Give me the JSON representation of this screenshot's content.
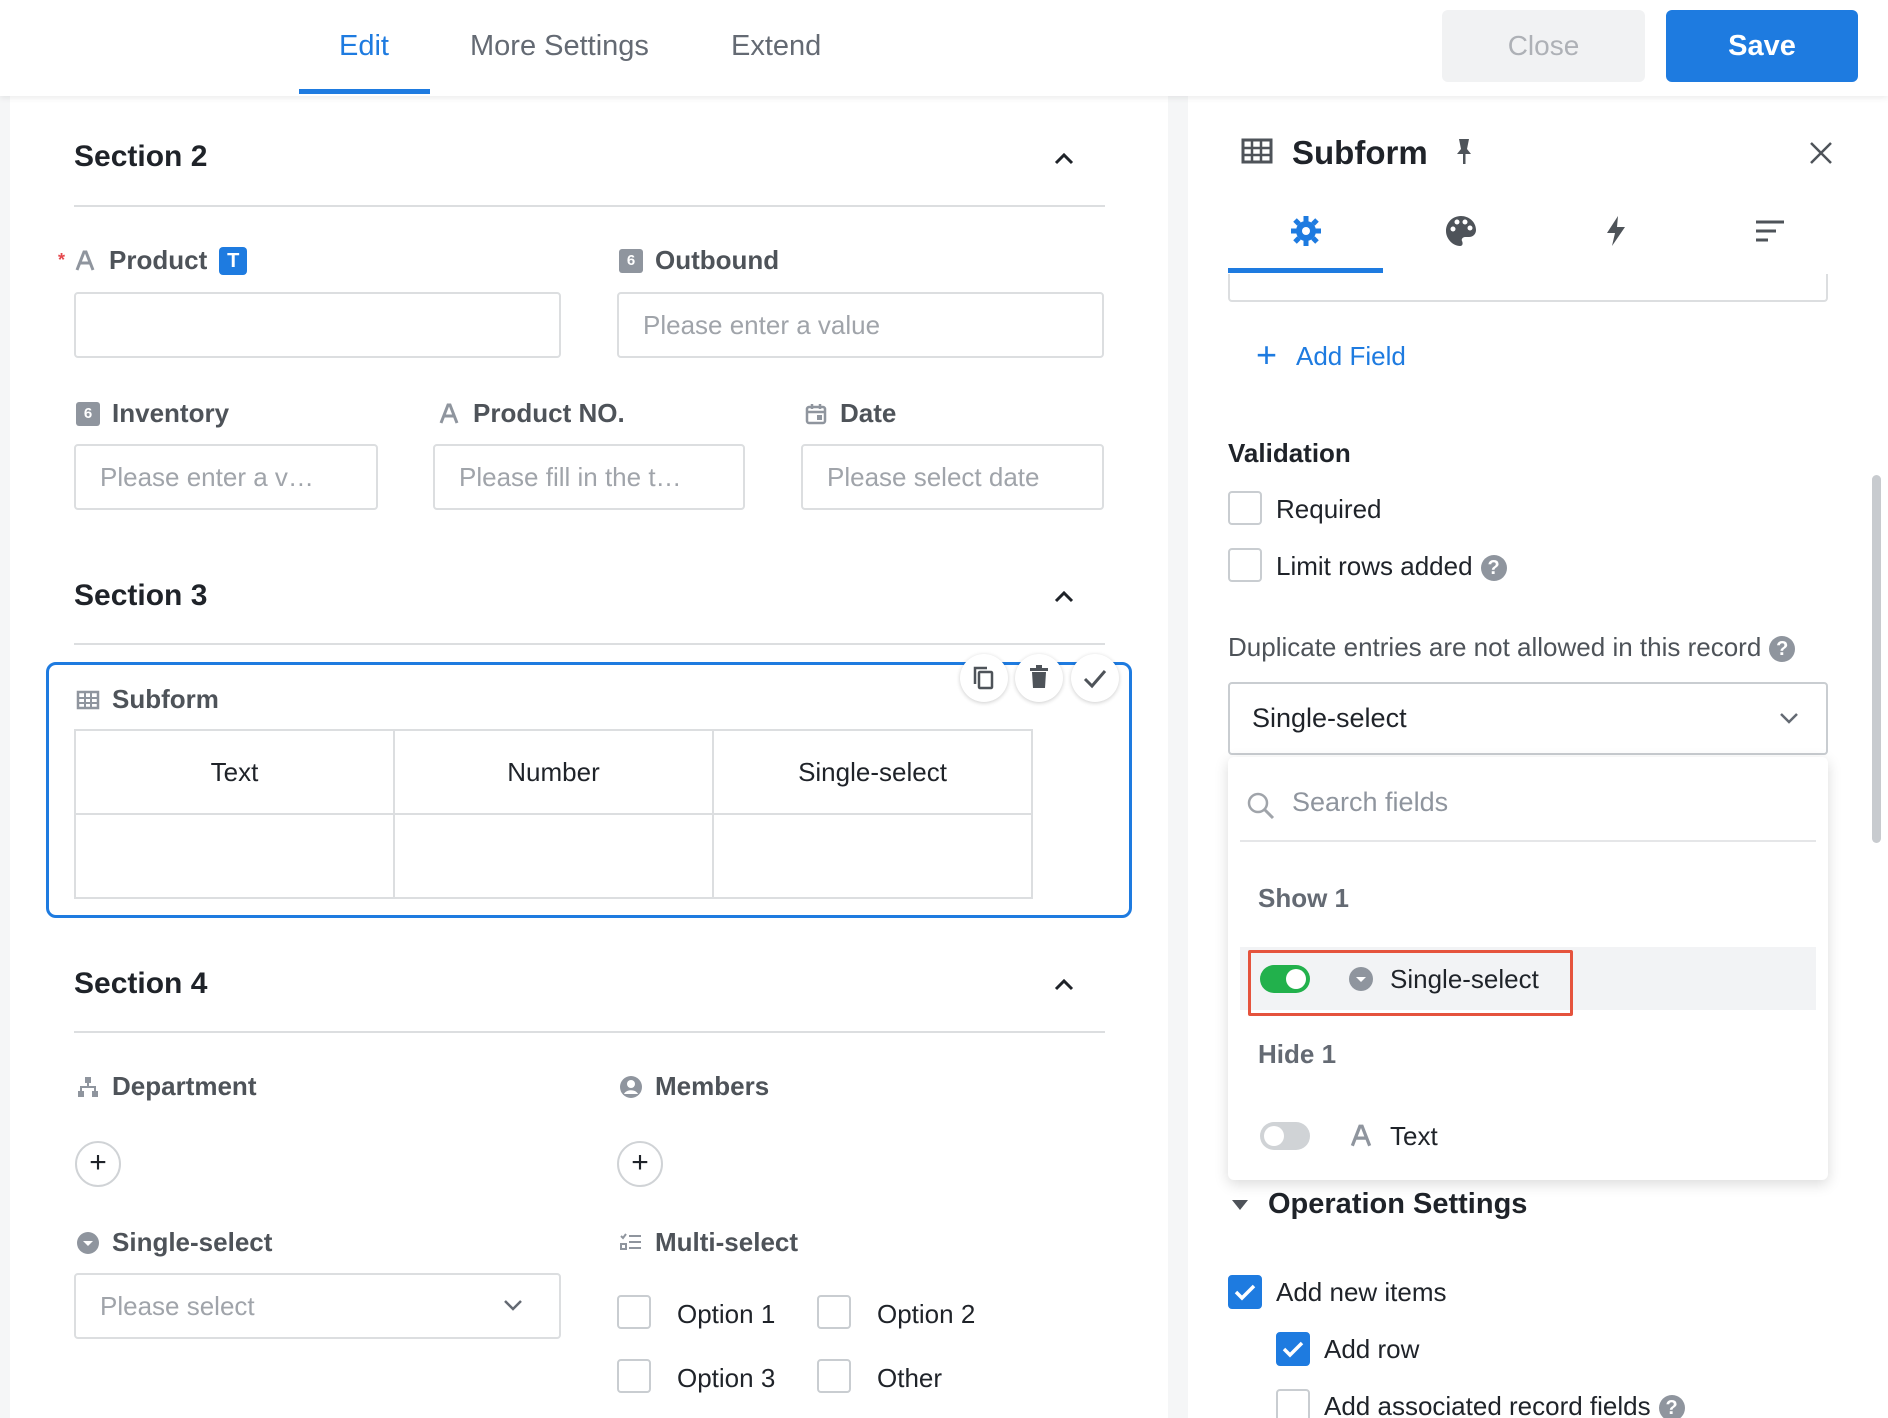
{
  "header": {
    "tabs": [
      {
        "label": "Edit",
        "active": true
      },
      {
        "label": "More Settings",
        "active": false
      },
      {
        "label": "Extend",
        "active": false
      }
    ],
    "close_label": "Close",
    "save_label": "Save",
    "accent_color": "#1e7be0"
  },
  "canvas": {
    "section2": {
      "title": "Section 2",
      "product_label": "Product",
      "product_badge": "T",
      "outbound_label": "Outbound",
      "outbound_placeholder": "Please enter a value",
      "inventory_label": "Inventory",
      "inventory_placeholder": "Please enter a v…",
      "product_no_label": "Product NO.",
      "product_no_placeholder": "Please fill in the t…",
      "date_label": "Date",
      "date_placeholder": "Please select date"
    },
    "section3": {
      "title": "Section 3",
      "subform_label": "Subform",
      "columns": [
        "Text",
        "Number",
        "Single-select"
      ]
    },
    "section4": {
      "title": "Section 4",
      "department_label": "Department",
      "members_label": "Members",
      "single_select_label": "Single-select",
      "single_select_placeholder": "Please select",
      "multi_select_label": "Multi-select",
      "options": [
        "Option 1",
        "Option 2",
        "Option 3",
        "Other"
      ]
    }
  },
  "panel": {
    "title": "Subform",
    "icon_tabs": [
      "gear-icon",
      "palette-icon",
      "lightning-icon",
      "sort-lines-icon"
    ],
    "add_field_label": "Add Field",
    "validation": {
      "title": "Validation",
      "required_label": "Required",
      "limit_rows_label": "Limit rows added"
    },
    "duplicate_label": "Duplicate entries are not allowed in this record",
    "dropdown_value": "Single-select",
    "popup": {
      "search_placeholder": "Search fields",
      "show_header": "Show 1",
      "show_item": "Single-select",
      "hide_header": "Hide 1",
      "hide_item": "Text"
    },
    "operation": {
      "title": "Operation Settings",
      "add_new_items_label": "Add new items",
      "add_row_label": "Add row",
      "add_associated_label": "Add associated record fields"
    }
  }
}
